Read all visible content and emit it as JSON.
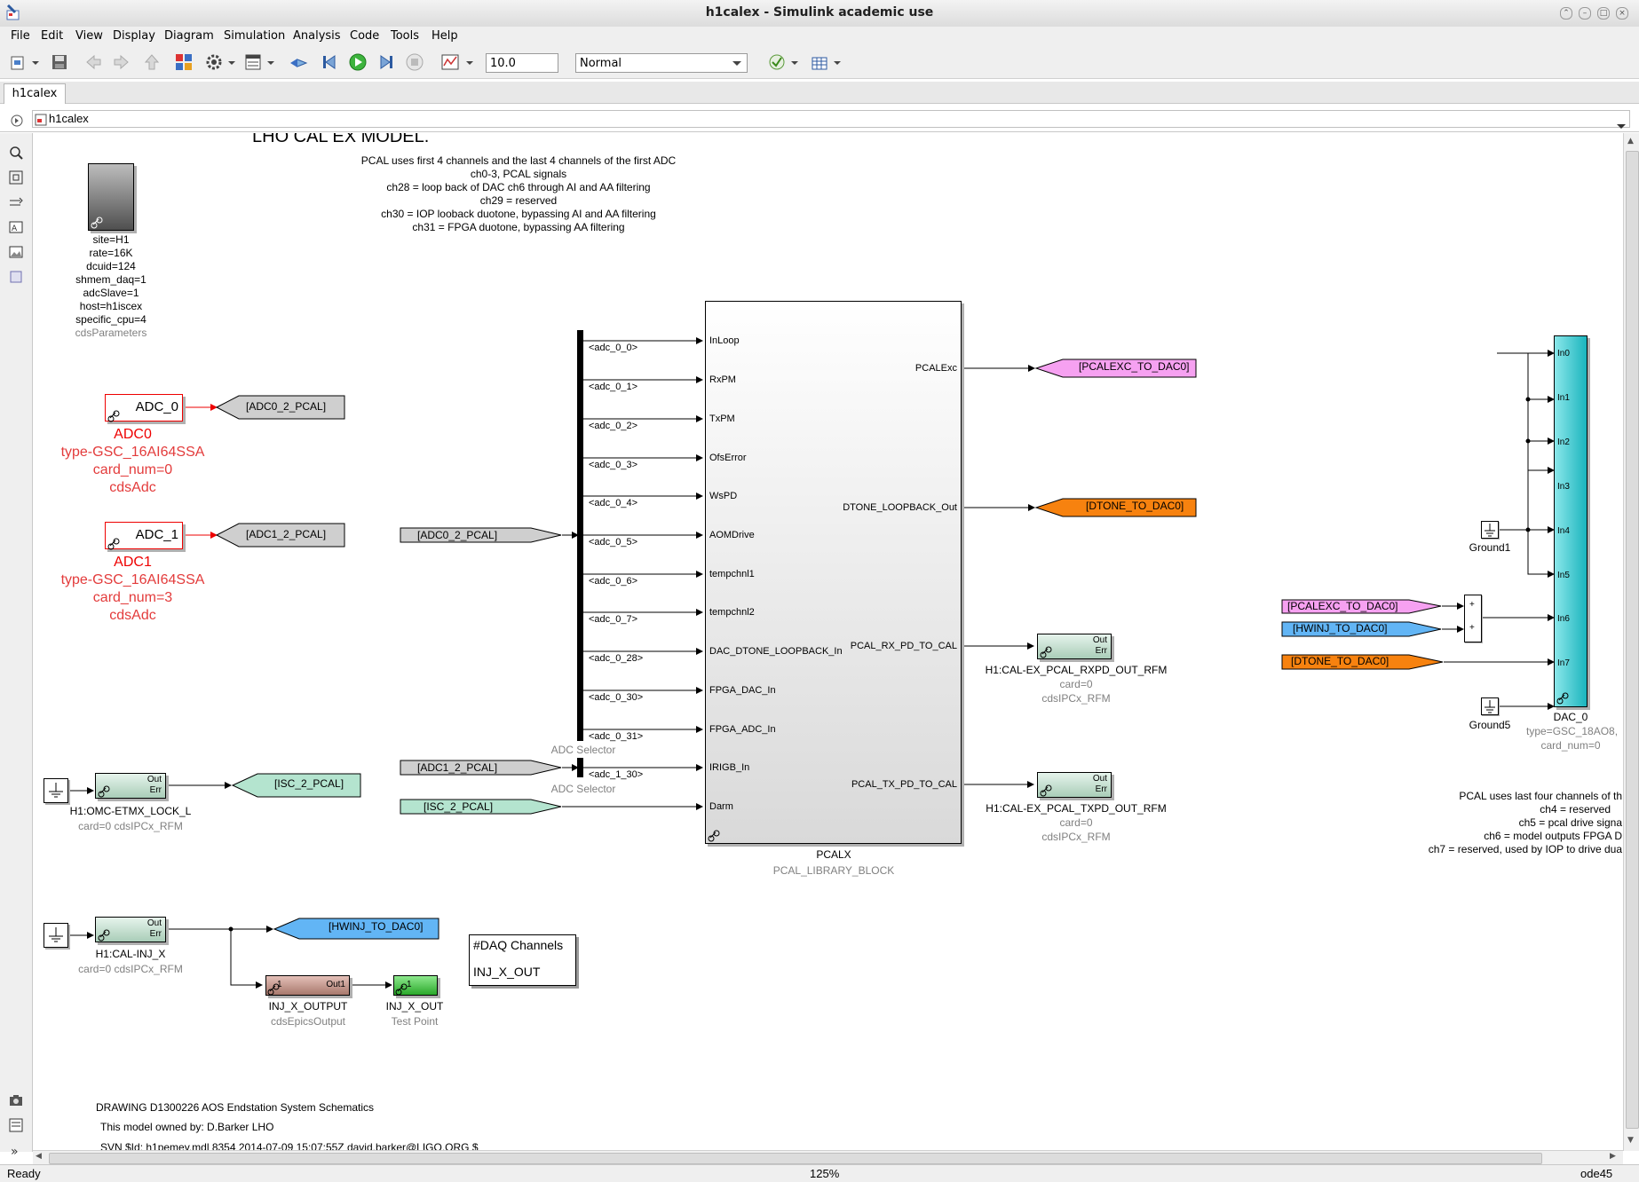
{
  "window": {
    "title": "h1calex - Simulink academic use"
  },
  "menu": [
    "File",
    "Edit",
    "View",
    "Display",
    "Diagram",
    "Simulation",
    "Analysis",
    "Code",
    "Tools",
    "Help"
  ],
  "toolbar": {
    "stop_time": "10.0",
    "sim_mode": "Normal"
  },
  "tab": {
    "label": "h1calex"
  },
  "address": {
    "path": "h1calex"
  },
  "status": {
    "left": "Ready",
    "zoom": "125%",
    "solver": "ode45"
  },
  "diagram": {
    "title": "LHO CAL EX MODEL.",
    "pcal_notes": [
      "PCAL uses first 4 channels and the last 4 channels of the first ADC",
      "ch0-3, PCAL signals",
      "ch28 = loop back of DAC ch6 through AI and AA filtering",
      "ch29 = reserved",
      "ch30 = IOP looback duotone, bypassing AI and AA filtering",
      "ch31 = FPGA duotone, bypassing AA filtering"
    ],
    "cds_params": {
      "lines": [
        "site=H1",
        "rate=16K",
        "dcuid=124",
        "shmem_daq=1",
        "adcSlave=1",
        "host=h1iscex",
        "specific_cpu=4"
      ],
      "name": "cdsParameters"
    },
    "adc0": {
      "block": "ADC_0",
      "lines": [
        "ADC0",
        "type-GSC_16AI64SSA",
        "card_num=0",
        "cdsAdc"
      ],
      "goto": "[ADC0_2_PCAL]"
    },
    "adc1": {
      "block": "ADC_1",
      "lines": [
        "ADC1",
        "type-GSC_16AI64SSA",
        "card_num=3",
        "cdsAdc"
      ],
      "goto": "[ADC1_2_PCAL]"
    },
    "selector": {
      "from0": "[ADC0_2_PCAL]",
      "from1": "[ADC1_2_PCAL]",
      "from_isc": "[ISC_2_PCAL]",
      "signals": [
        "<adc_0_0>",
        "<adc_0_1>",
        "<adc_0_2>",
        "<adc_0_3>",
        "<adc_0_4>",
        "<adc_0_5>",
        "<adc_0_6>",
        "<adc_0_7>",
        "<adc_0_28>",
        "<adc_0_30>",
        "<adc_0_31>"
      ],
      "signal2": "<adc_1_30>",
      "name": "ADC Selector"
    },
    "pcalx": {
      "inputs": [
        "InLoop",
        "RxPM",
        "TxPM",
        "OfsError",
        "WsPD",
        "AOMDrive",
        "tempchnl1",
        "tempchnl2",
        "DAC_DTONE_LOOPBACK_In",
        "FPGA_DAC_In",
        "FPGA_ADC_In",
        "IRIGB_In",
        "Darm"
      ],
      "outputs": [
        "PCALExc",
        "DTONE_LOOPBACK_Out",
        "PCAL_RX_PD_TO_CAL",
        "PCAL_TX_PD_TO_CAL"
      ],
      "name": "PCALX",
      "lib": "PCAL_LIBRARY_BLOCK"
    },
    "gotos_right": {
      "pcalexc": "[PCALEXC_TO_DAC0]",
      "dtone": "[DTONE_TO_DAC0]"
    },
    "rxpd": {
      "name": "H1:CAL-EX_PCAL_RXPD_OUT_RFM",
      "card": "card=0",
      "type": "cdsIPCx_RFM",
      "p1": "Out",
      "p2": "Err"
    },
    "txpd": {
      "name": "H1:CAL-EX_PCAL_TXPD_OUT_RFM",
      "card": "card=0",
      "type": "cdsIPCx_RFM",
      "p1": "Out",
      "p2": "Err"
    },
    "omc": {
      "name": "H1:OMC-ETMX_LOCK_L",
      "sub": "card=0 cdsIPCx_RFM",
      "goto": "[ISC_2_PCAL]",
      "p1": "Out",
      "p2": "Err"
    },
    "inj": {
      "name": "H1:CAL-INJ_X",
      "sub": "card=0 cdsIPCx_RFM",
      "goto": "[HWINJ_TO_DAC0]",
      "p1": "Out",
      "p2": "Err"
    },
    "epics": {
      "port_in": "1",
      "port_out": "Out1",
      "name": "INJ_X_OUTPUT",
      "type": "cdsEpicsOutput"
    },
    "testpoint": {
      "port": "1",
      "name": "INJ_X_OUT",
      "type": "Test Point"
    },
    "daq": {
      "title": "#DAQ Channels",
      "channel": "INJ_X_OUT"
    },
    "dac": {
      "inputs": [
        "In0",
        "In1",
        "In2",
        "In3",
        "In4",
        "In5",
        "In6",
        "In7"
      ],
      "name": "DAC_0",
      "type": "type=GSC_18AO8,",
      "card": "card_num=0",
      "ground1": "Ground1",
      "ground5": "Ground5",
      "from_pcalexc": "[PCALEXC_TO_DAC0]",
      "from_hwinj": "[HWINJ_TO_DAC0]",
      "from_dtone": "[DTONE_TO_DAC0]",
      "sum_sign": "+"
    },
    "dac_notes": [
      "PCAL uses last four channels of th",
      "ch4 = reserved",
      "ch5 = pcal drive signa",
      "ch6 = model outputs FPGA D",
      "ch7 = reserved, used by IOP to drive dua"
    ],
    "footer": [
      "DRAWING D1300226 AOS Endstation System Schematics",
      "This model owned by: D.Barker LHO",
      "SVN $Id: h1pemey.mdl 8354 2014-07-09 15:07:55Z david.barker@LIGO.ORG $"
    ]
  }
}
